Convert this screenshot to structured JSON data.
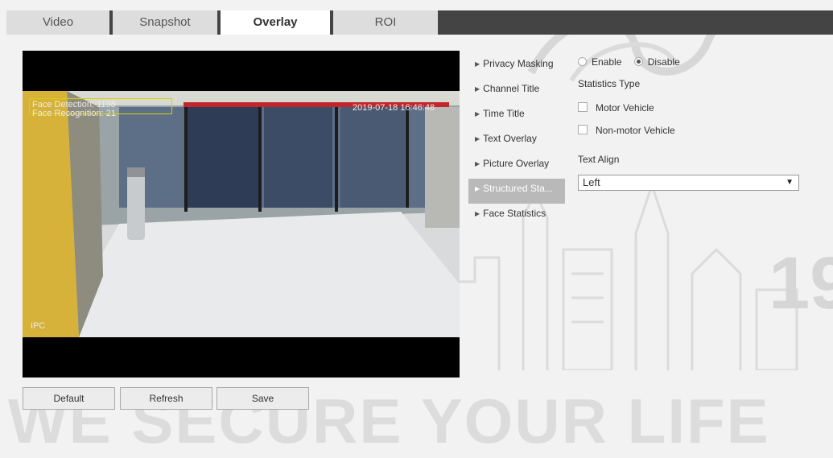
{
  "tabs": [
    {
      "label": "Video",
      "active": false
    },
    {
      "label": "Snapshot",
      "active": false
    },
    {
      "label": "Overlay",
      "active": true
    },
    {
      "label": "ROI",
      "active": false
    }
  ],
  "video": {
    "osd": {
      "face_detection": "Face Detection: 1138",
      "face_recognition": "Face Recognition: 21",
      "timestamp": "2019-07-18 16:46:48",
      "channel_title": "IPC"
    }
  },
  "menu": {
    "items": [
      {
        "label": "Privacy Masking",
        "active": false
      },
      {
        "label": "Channel Title",
        "active": false
      },
      {
        "label": "Time Title",
        "active": false
      },
      {
        "label": "Text Overlay",
        "active": false
      },
      {
        "label": "Picture Overlay",
        "active": false
      },
      {
        "label": "Structured Sta...",
        "active": true
      },
      {
        "label": "Face Statistics",
        "active": false
      }
    ]
  },
  "panel": {
    "enable_label": "Enable",
    "disable_label": "Disable",
    "enabled": false,
    "statistics_type_label": "Statistics Type",
    "motor_vehicle_label": "Motor Vehicle",
    "non_motor_vehicle_label": "Non-motor Vehicle",
    "motor_vehicle_checked": false,
    "non_motor_vehicle_checked": false,
    "text_align_label": "Text Align",
    "text_align_value": "Left",
    "select_arrow": "▼"
  },
  "buttons": {
    "default_label": "Default",
    "refresh_label": "Refresh",
    "save_label": "Save"
  },
  "watermark": {
    "slogan": "WE SECURE YOUR LIFE",
    "year_fragment": "19"
  },
  "colors": {
    "tab_bar": "#444444",
    "active_menu": "#b9b9b9",
    "osd_box": "#d8d000",
    "osd_red_bar": "#c0272d"
  }
}
